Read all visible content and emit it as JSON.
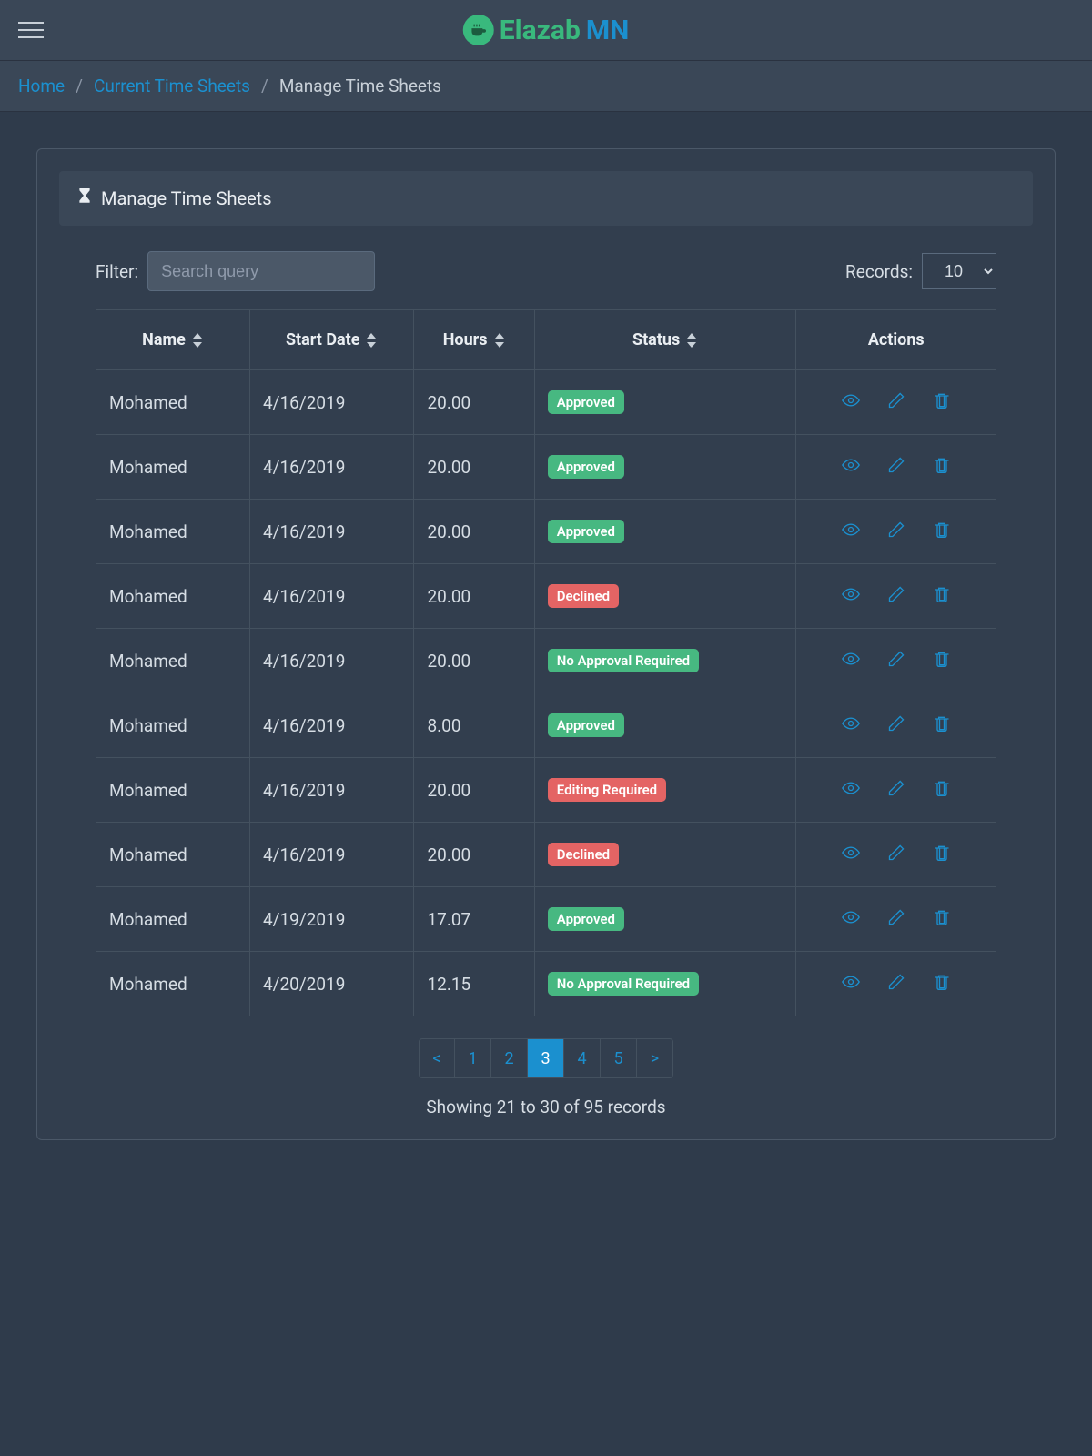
{
  "brand": {
    "part1": "Elazab",
    "part2": "MN"
  },
  "breadcrumb": {
    "items": [
      {
        "label": "Home",
        "link": true
      },
      {
        "label": "Current Time Sheets",
        "link": true
      },
      {
        "label": "Manage Time Sheets",
        "link": false
      }
    ]
  },
  "card": {
    "title": "Manage Time Sheets"
  },
  "filter": {
    "label": "Filter:",
    "placeholder": "Search query",
    "value": ""
  },
  "records": {
    "label": "Records:",
    "options": [
      "10"
    ],
    "selected": "10"
  },
  "table": {
    "columns": [
      "Name",
      "Start Date",
      "Hours",
      "Status",
      "Actions"
    ],
    "rows": [
      {
        "name": "Mohamed",
        "start_date": "4/16/2019",
        "hours": "20.00",
        "status": "Approved",
        "status_color": "green"
      },
      {
        "name": "Mohamed",
        "start_date": "4/16/2019",
        "hours": "20.00",
        "status": "Approved",
        "status_color": "green"
      },
      {
        "name": "Mohamed",
        "start_date": "4/16/2019",
        "hours": "20.00",
        "status": "Approved",
        "status_color": "green"
      },
      {
        "name": "Mohamed",
        "start_date": "4/16/2019",
        "hours": "20.00",
        "status": "Declined",
        "status_color": "red"
      },
      {
        "name": "Mohamed",
        "start_date": "4/16/2019",
        "hours": "20.00",
        "status": "No Approval Required",
        "status_color": "green"
      },
      {
        "name": "Mohamed",
        "start_date": "4/16/2019",
        "hours": "8.00",
        "status": "Approved",
        "status_color": "green"
      },
      {
        "name": "Mohamed",
        "start_date": "4/16/2019",
        "hours": "20.00",
        "status": "Editing Required",
        "status_color": "red"
      },
      {
        "name": "Mohamed",
        "start_date": "4/16/2019",
        "hours": "20.00",
        "status": "Declined",
        "status_color": "red"
      },
      {
        "name": "Mohamed",
        "start_date": "4/19/2019",
        "hours": "17.07",
        "status": "Approved",
        "status_color": "green"
      },
      {
        "name": "Mohamed",
        "start_date": "4/20/2019",
        "hours": "12.15",
        "status": "No Approval Required",
        "status_color": "green"
      }
    ]
  },
  "pagination": {
    "prev": "<",
    "next": ">",
    "pages": [
      "1",
      "2",
      "3",
      "4",
      "5"
    ],
    "active": "3"
  },
  "showing": "Showing 21 to 30 of 95 records"
}
